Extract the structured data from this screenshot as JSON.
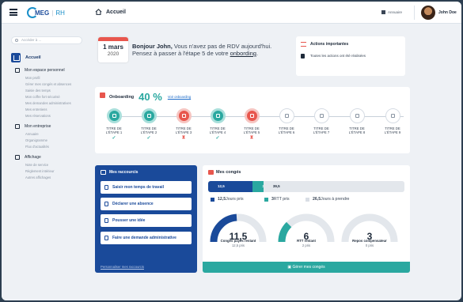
{
  "topbar": {
    "logo_meg": "MEG",
    "logo_sep": "|",
    "logo_rh": "RH",
    "page_title": "Accueil",
    "directory_label": "Annuaire",
    "user_name": "John Doe"
  },
  "sidebar": {
    "search_placeholder": "Accéder à ...",
    "home_label": "Accueil",
    "sections": [
      {
        "label": "Mon espace personnel",
        "icon": "person-icon",
        "items": [
          "Mon profil",
          "Gérer mes congés et absences",
          "Saisie des temps",
          "Mon coffre fort sécurisé",
          "Mes demandes administratives",
          "Mes entretiens",
          "Mes réservations"
        ]
      },
      {
        "label": "Mon entreprise",
        "icon": "grid-icon",
        "items": [
          "Annuaire",
          "Organigramme",
          "Flux d'actualités"
        ]
      },
      {
        "label": "Affichage",
        "icon": "copy-icon",
        "items": [
          "Note de service",
          "Règlement intérieur",
          "Autres affichages"
        ]
      }
    ]
  },
  "greeting": {
    "cal_month_tag": "",
    "cal_day": "1 mars",
    "cal_year": "2020",
    "hello": "Bonjour John,",
    "line1": " Vous n'avez pas de RDV aujourd'hui.",
    "line2": "Pensez à passer à l'étape 5 de votre ",
    "link": "onbording",
    "line2_end": "."
  },
  "actions": {
    "title": "Actions importantes",
    "text": "Toutes les actions ont été réalisées"
  },
  "onboarding": {
    "title": "Onboarding",
    "percent": "40 %",
    "link": "Voir onboarding",
    "steps": [
      {
        "line1": "TITRE DE",
        "line2": "L'ÉTAPE 1",
        "status": "done",
        "mark": "✓"
      },
      {
        "line1": "TITRE DE",
        "line2": "L'ÉTAPE 2",
        "status": "done",
        "mark": "✓"
      },
      {
        "line1": "TITRE DE",
        "line2": "L'ÉTAPE 3",
        "status": "todo",
        "mark": "⧗"
      },
      {
        "line1": "TITRE DE",
        "line2": "L'ÉTAPE 4",
        "status": "done",
        "mark": "✓"
      },
      {
        "line1": "TITRE DE",
        "line2": "L'ÉTAPE 5",
        "status": "todo",
        "mark": "⧗"
      },
      {
        "line1": "TITRE DE",
        "line2": "L'ÉTAPE 6",
        "status": "none",
        "mark": ""
      },
      {
        "line1": "TITRE DE",
        "line2": "L'ÉTAPE 7",
        "status": "none",
        "mark": ""
      },
      {
        "line1": "TITRE DE",
        "line2": "L'ÉTAPE 8",
        "status": "none",
        "mark": ""
      },
      {
        "line1": "TITRE DE",
        "line2": "L'ÉTAPE 9",
        "status": "none",
        "mark": ""
      }
    ]
  },
  "shortcuts": {
    "title": "Mes raccourcis",
    "buttons": [
      "Saisir mon temps de travail",
      "Déclarer une absence",
      "Pousser une idée",
      "Faire une demande administrative"
    ],
    "footer": "Personnaliser mes raccourcis"
  },
  "leave": {
    "title": "Mes congés",
    "bar": [
      {
        "label": "12,5",
        "value": 12.5,
        "color": "#1a4a9a"
      },
      {
        "label": "3",
        "value": 3,
        "color": "#2aa8a0"
      },
      {
        "label": "39,5",
        "value": 39.5,
        "color": "#e3e7ec"
      }
    ],
    "legend": [
      {
        "bold": "12,5",
        "text": " Jours pris",
        "color": "#1a4a9a"
      },
      {
        "bold": "3",
        "text": " RTT pris",
        "color": "#2aa8a0"
      },
      {
        "bold": "26,5",
        "text": " Jours à prendre",
        "color": "#d9dee5"
      }
    ],
    "gauges": [
      {
        "value": "11,5",
        "label": "Congés payés restant",
        "sub": "12,5 pris",
        "fraction": 0.48,
        "color": "#1a4a9a"
      },
      {
        "value": "6",
        "label": "RTT restant",
        "sub": "2 pris",
        "fraction": 0.25,
        "color": "#2aa8a0"
      },
      {
        "value": "3",
        "label": "Repos compensateur",
        "sub": "0 pris",
        "fraction": 0.0,
        "color": "#2aa8a0"
      }
    ],
    "manage_button": "Gérer mes congés"
  }
}
